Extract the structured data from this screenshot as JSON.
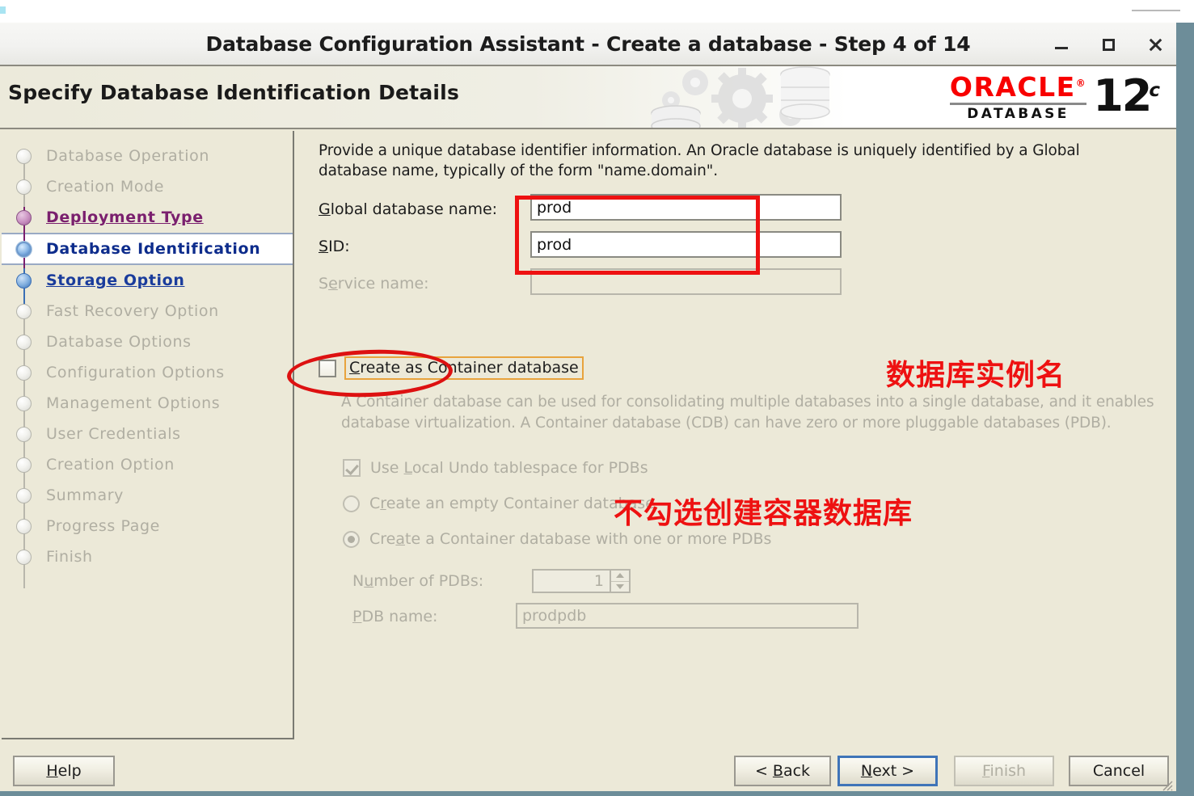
{
  "window": {
    "title": "Database Configuration Assistant - Create a database - Step 4 of 14",
    "minimize_label": "minimize",
    "maximize_label": "maximize",
    "close_label": "close"
  },
  "banner": {
    "page_title": "Specify Database Identification Details",
    "brand": "ORACLE",
    "brand_sub": "DATABASE",
    "version_number": "12",
    "version_suffix": "c"
  },
  "sidebar": {
    "items": [
      {
        "label": "Database Operation",
        "state": "pending"
      },
      {
        "label": "Creation Mode",
        "state": "pending"
      },
      {
        "label": "Deployment Type",
        "state": "done"
      },
      {
        "label": "Database Identification",
        "state": "current"
      },
      {
        "label": "Storage Option",
        "state": "visited"
      },
      {
        "label": "Fast Recovery Option",
        "state": "pending"
      },
      {
        "label": "Database Options",
        "state": "pending"
      },
      {
        "label": "Configuration Options",
        "state": "pending"
      },
      {
        "label": "Management Options",
        "state": "pending"
      },
      {
        "label": "User Credentials",
        "state": "pending"
      },
      {
        "label": "Creation Option",
        "state": "pending"
      },
      {
        "label": "Summary",
        "state": "pending"
      },
      {
        "label": "Progress Page",
        "state": "pending"
      },
      {
        "label": "Finish",
        "state": "pending"
      }
    ]
  },
  "main": {
    "intro": "Provide a unique database identifier information. An Oracle database is uniquely identified by a Global database name, typically of the form \"name.domain\".",
    "global_db_name_label": "Global database name:",
    "global_db_name_value": "prod",
    "sid_label": "SID:",
    "sid_value": "prod",
    "service_name_label": "Service name:",
    "service_name_value": "",
    "create_container_label": "Create as Container database",
    "create_container_checked": false,
    "container_desc": "A Container database can be used for consolidating multiple databases into a single database, and it enables database virtualization. A Container database (CDB) can have zero or more pluggable databases (PDB).",
    "local_undo_label": "Use Local Undo tablespace for PDBs",
    "local_undo_checked": true,
    "empty_cdb_label": "Create an empty Container database",
    "empty_cdb_selected": false,
    "cdb_with_pdbs_label": "Create a Container database with one or more PDBs",
    "cdb_with_pdbs_selected": true,
    "num_pdbs_label": "Number of PDBs:",
    "num_pdbs_value": "1",
    "pdb_name_label": "PDB name:",
    "pdb_name_value": "prodpdb"
  },
  "annotations": {
    "instance_name_note": "数据库实例名",
    "no_container_note": "不勾选创建容器数据库",
    "color": "#ee1111"
  },
  "footer": {
    "help": "Help",
    "back": "< Back",
    "next": "Next >",
    "finish": "Finish",
    "cancel": "Cancel"
  }
}
